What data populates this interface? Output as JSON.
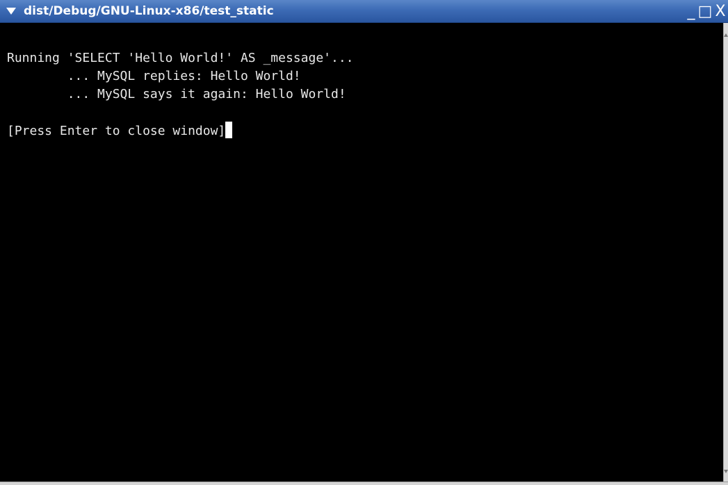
{
  "window": {
    "title": "dist/Debug/GNU-Linux-x86/test_static",
    "menu_icon": "triangle-down-icon",
    "minimize_glyph": "_",
    "maximize_glyph": "□",
    "close_glyph": "X",
    "titlebar_color": "#3c6bb5"
  },
  "terminal": {
    "lines": [
      "Running 'SELECT 'Hello World!' AS _message'...",
      "        ... MySQL replies: Hello World!",
      "        ... MySQL says it again: Hello World!",
      "",
      "[Press Enter to close window]"
    ],
    "background": "#000000",
    "foreground": "#e8e8e8"
  }
}
